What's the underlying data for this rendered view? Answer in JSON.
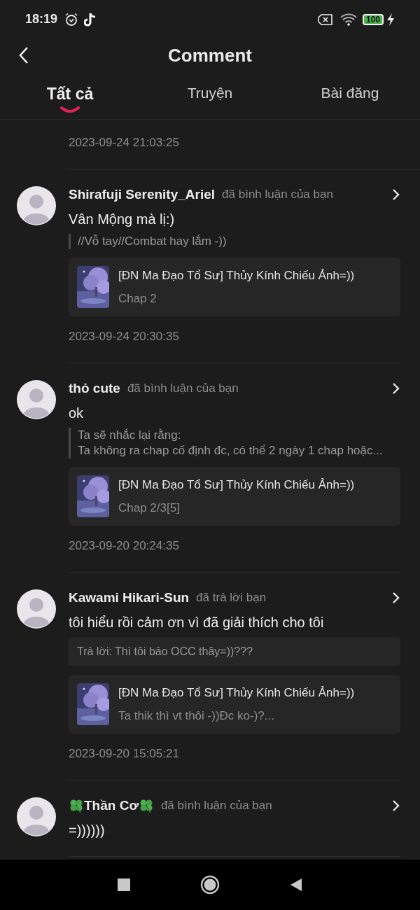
{
  "status_bar": {
    "time": "18:19",
    "battery": "100"
  },
  "header": {
    "title": "Comment"
  },
  "tabs": [
    {
      "label": "Tất cả",
      "selected": true
    },
    {
      "label": "Truyện",
      "selected": false
    },
    {
      "label": "Bài đăng",
      "selected": false
    }
  ],
  "top_timestamp": "2023-09-24 21:03:25",
  "comments": [
    {
      "name": "Shirafuji Serenity_Ariel",
      "decorated": false,
      "action": "đã bình luận của bạn",
      "body": "Vân Mộng mà lị:)",
      "quote": {
        "kind": "quote",
        "lines": [
          "//Vỗ tay//Combat hay lắm -))"
        ]
      },
      "card": {
        "title": "[ĐN Ma Đạo Tổ Sư] Thủy Kính Chiếu Ảnh=))",
        "subtitle": "Chap 2"
      },
      "timestamp": "2023-09-24 20:30:35"
    },
    {
      "name": "thỏ cute",
      "decorated": false,
      "action": "đã bình luận của bạn",
      "body": "ok",
      "quote": {
        "kind": "quote",
        "lines": [
          "Ta sẽ nhắc lại rằng:",
          "Ta không ra chap cố định đc, có thể 2 ngày 1 chap hoặc..."
        ]
      },
      "card": {
        "title": "[ĐN Ma Đạo Tổ Sư] Thủy Kính Chiếu Ảnh=))",
        "subtitle": "Chap 2/3[5]"
      },
      "timestamp": "2023-09-20 20:24:35"
    },
    {
      "name": "Kawami Hikari-Sun",
      "decorated": false,
      "action": "đã trả lời bạn",
      "body": "tôi hiểu rồi cảm ơn vì đã giải thích cho tôi",
      "quote": {
        "kind": "reply",
        "lines": [
          "Trả lời: Thì tôi bảo OCC thây=))???"
        ]
      },
      "card": {
        "title": "[ĐN Ma Đạo Tổ Sư] Thủy Kính Chiếu Ảnh=))",
        "subtitle": "Ta thik thì vt thôi -))Đc ko-)?..."
      },
      "timestamp": "2023-09-20 15:05:21"
    },
    {
      "name": "Thần Cơ",
      "decorated": true,
      "action": "đã bình luận của bạn",
      "body": "=))))))"
    }
  ]
}
